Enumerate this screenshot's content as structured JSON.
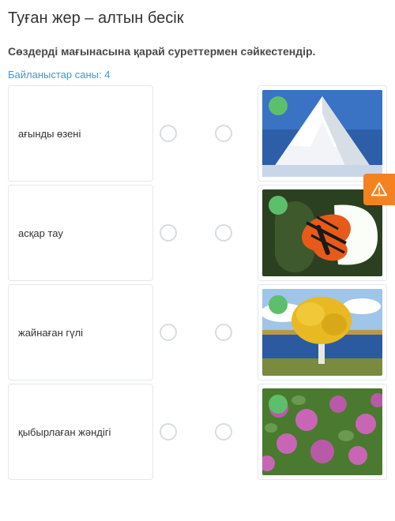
{
  "title": "Туған жер – алтын бесік",
  "instruction": "Сөздерді мағынасына қарай суреттермен сәйкестендір.",
  "count_label": "Байланыстар саны: 4",
  "items": [
    {
      "term": "ағынды өзені",
      "image_name": "mountain-image"
    },
    {
      "term": "асқар тау",
      "image_name": "butterfly-image"
    },
    {
      "term": "жайнаған гүлі",
      "image_name": "autumn-tree-image"
    },
    {
      "term": "қыбырлаған жәндігі",
      "image_name": "clover-field-image"
    }
  ]
}
